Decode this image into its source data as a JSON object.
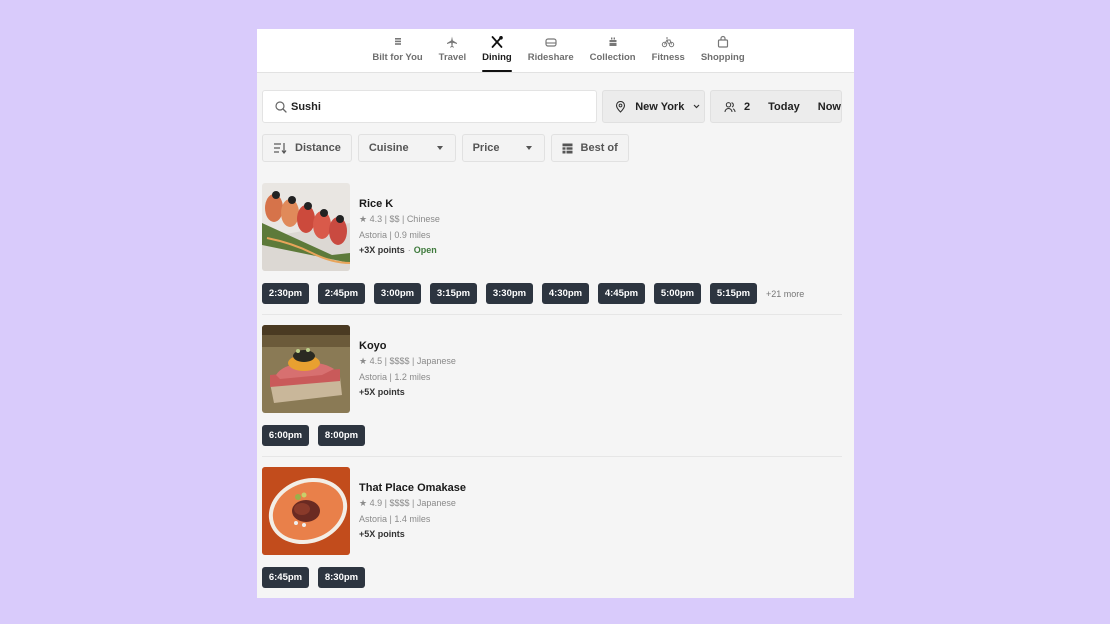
{
  "nav": {
    "items": [
      {
        "label": "Bilt for You",
        "icon": "grid-icon",
        "active": false
      },
      {
        "label": "Travel",
        "icon": "airplane-icon",
        "active": false
      },
      {
        "label": "Dining",
        "icon": "utensils-icon",
        "active": true
      },
      {
        "label": "Rideshare",
        "icon": "car-icon",
        "active": false
      },
      {
        "label": "Collection",
        "icon": "gift-icon",
        "active": false
      },
      {
        "label": "Fitness",
        "icon": "bicycle-icon",
        "active": false
      },
      {
        "label": "Shopping",
        "icon": "shopping-bag-icon",
        "active": false
      }
    ]
  },
  "search": {
    "value": "Sushi",
    "icon": "search-icon"
  },
  "location": {
    "label": "New York",
    "icon": "map-pin-icon"
  },
  "party": {
    "size": "2",
    "date": "Today",
    "time": "Now",
    "icon": "people-icon"
  },
  "filters": [
    {
      "label": "Distance",
      "icon": "sort-icon"
    },
    {
      "label": "Cuisine",
      "dropdown": true
    },
    {
      "label": "Price",
      "dropdown": true
    },
    {
      "label": "Best of",
      "icon": "list-icon"
    }
  ],
  "restaurants": [
    {
      "name": "Rice K",
      "rating": "4.3",
      "price": "$$",
      "cuisine": "Chinese",
      "neighborhood": "Astoria",
      "distance": "0.9 miles",
      "points": "+3X points",
      "status": "Open",
      "slots": [
        "2:30pm",
        "2:45pm",
        "3:00pm",
        "3:15pm",
        "3:30pm",
        "4:30pm",
        "4:45pm",
        "5:00pm",
        "5:15pm"
      ],
      "more": "+21 more"
    },
    {
      "name": "Koyo",
      "rating": "4.5",
      "price": "$$$$",
      "cuisine": "Japanese",
      "neighborhood": "Astoria",
      "distance": "1.2 miles",
      "points": "+5X points",
      "slots": [
        "6:00pm",
        "8:00pm"
      ]
    },
    {
      "name": "That Place Omakase",
      "rating": "4.9",
      "price": "$$$$",
      "cuisine": "Japanese",
      "neighborhood": "Astoria",
      "distance": "1.4 miles",
      "points": "+5X points",
      "slots": [
        "6:45pm",
        "8:30pm"
      ]
    }
  ],
  "meta_separator": " | ",
  "star": "★"
}
